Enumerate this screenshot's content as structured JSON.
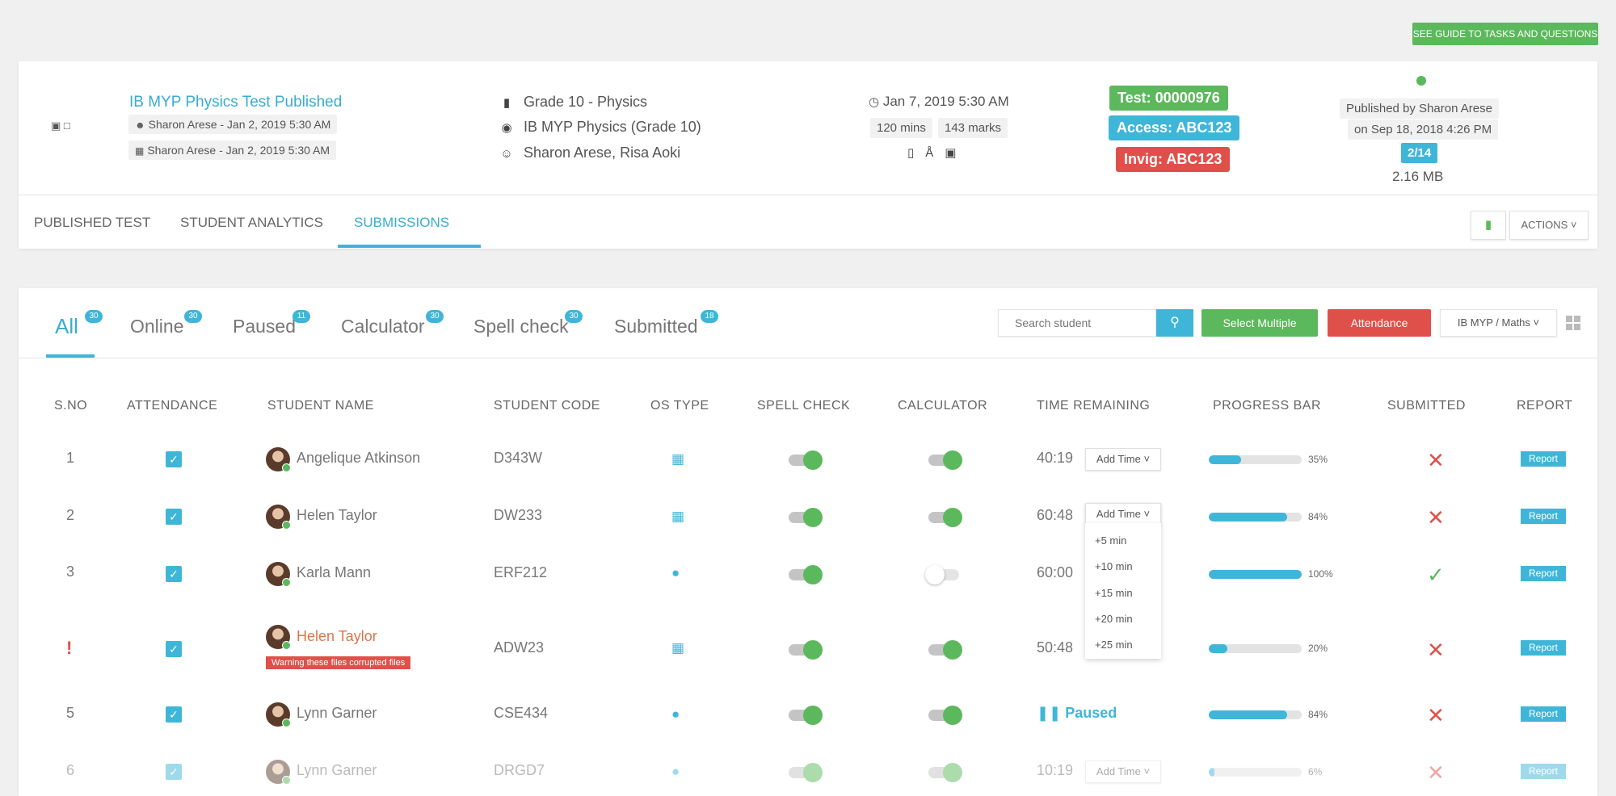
{
  "guide_button": "SEE GUIDE TO TASKS AND QUESTIONS",
  "test": {
    "title": "IB MYP Physics Test Published",
    "created_by": "Sharon Arese - Jan 2, 2019 5:30 AM",
    "scheduled_by": "Sharon Arese - Jan 2, 2019 5:30 AM",
    "grade": "Grade 10 - Physics",
    "course": "IB MYP Physics (Grade 10)",
    "teachers": "Sharon Arese, Risa Aoki",
    "datetime": "Jan 7, 2019 5:30 AM",
    "duration": "120 mins",
    "marks": "143 marks",
    "test_code": "Test: 00000976",
    "access_code": "Access: ABC123",
    "invig_code": "Invig: ABC123",
    "published_by_line1": "Published by Sharon Arese",
    "published_by_line2": "on Sep 18, 2018 4:26 PM",
    "count": "2/14",
    "size": "2.16 MB"
  },
  "tabs": [
    "PUBLISHED TEST",
    "STUDENT ANALYTICS",
    "SUBMISSIONS"
  ],
  "actions_label": "ACTIONS",
  "filters": [
    {
      "label": "All",
      "count": "30"
    },
    {
      "label": "Online",
      "count": "30"
    },
    {
      "label": "Paused",
      "count": "11"
    },
    {
      "label": "Calculator",
      "count": "30"
    },
    {
      "label": "Spell check",
      "count": "30"
    },
    {
      "label": "Submitted",
      "count": "18"
    }
  ],
  "search_placeholder": "Search student",
  "select_multiple": "Select Multiple",
  "attendance_btn": "Attendance",
  "course_select": "IB MYP / Maths",
  "columns": [
    "S.NO",
    "ATTENDANCE",
    "STUDENT NAME",
    "STUDENT CODE",
    "OS TYPE",
    "SPELL CHECK",
    "CALCULATOR",
    "TIME REMAINING",
    "PROGRESS BAR",
    "SUBMITTED",
    "REPORT"
  ],
  "add_time_label": "Add Time",
  "add_time_options": [
    "+5 min",
    "+10 min",
    "+15 min",
    "+20 min",
    "+25 min"
  ],
  "report_label": "Report",
  "paused_label": "Paused",
  "warning_text": "Warning these files corrupted files",
  "rows": [
    {
      "sno": "1",
      "name": "Angelique Atkinson",
      "code": "D343W",
      "os": "windows",
      "time": "40:19",
      "progress_label": "35%",
      "progress": 35,
      "submitted": false
    },
    {
      "sno": "2",
      "name": "Helen Taylor",
      "code": "DW233",
      "os": "windows",
      "time": "60:48",
      "progress_label": "84%",
      "progress": 84,
      "submitted": false
    },
    {
      "sno": "3",
      "name": "Karla Mann",
      "code": "ERF212",
      "os": "apple",
      "time": "60:00",
      "progress_label": "100%",
      "progress": 100,
      "submitted": true
    },
    {
      "sno": "",
      "name": "Helen Taylor",
      "code": "ADW23",
      "os": "windows",
      "time": "50:48",
      "progress_label": "20%",
      "progress": 20,
      "submitted": false
    },
    {
      "sno": "5",
      "name": "Lynn Garner",
      "code": "CSE434",
      "os": "apple",
      "time": "",
      "progress_label": "84%",
      "progress": 84,
      "submitted": false
    },
    {
      "sno": "6",
      "name": "Lynn Garner",
      "code": "DRGD7",
      "os": "apple",
      "time": "10:19",
      "progress_label": "6%",
      "progress": 6,
      "submitted": false
    }
  ],
  "colors": {
    "accent": "#3fb6d8",
    "success": "#5cb85c",
    "danger": "#e0504a"
  }
}
